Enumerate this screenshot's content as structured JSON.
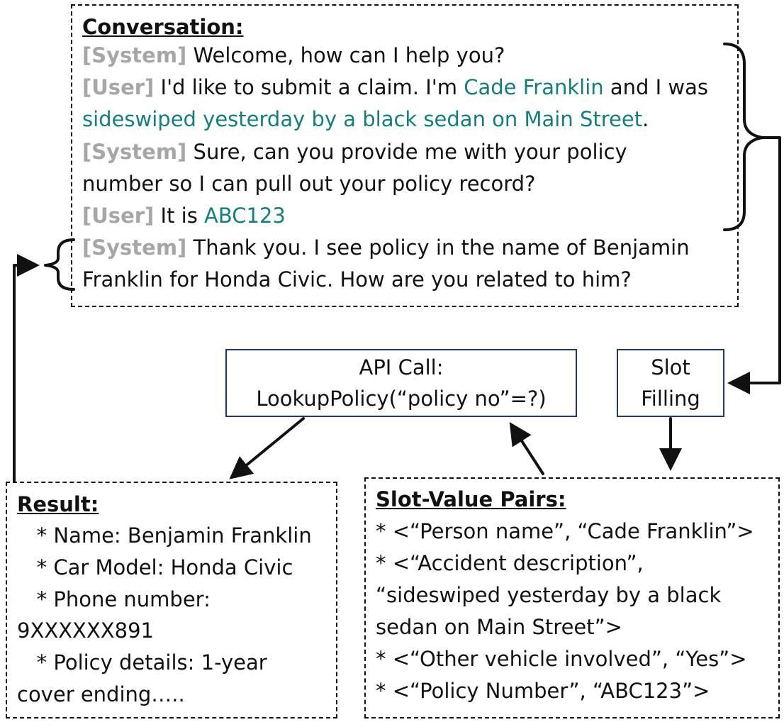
{
  "conversation": {
    "heading": "Conversation:",
    "lines": [
      {
        "tag": "[System]",
        "parts": [
          {
            "t": " Welcome, how can I help you?",
            "hl": false
          }
        ]
      },
      {
        "tag": "[User]",
        "parts": [
          {
            "t": " I'd like to submit a claim. I'm ",
            "hl": false
          },
          {
            "t": "Cade Franklin",
            "hl": true
          },
          {
            "t": " and I was",
            "hl": false
          }
        ]
      },
      {
        "tag": "",
        "parts": [
          {
            "t": "sideswiped yesterday by a black sedan on Main Street",
            "hl": true
          },
          {
            "t": ".",
            "hl": false
          }
        ]
      },
      {
        "tag": "[System]",
        "parts": [
          {
            "t": " Sure, can you provide me with your policy",
            "hl": false
          }
        ]
      },
      {
        "tag": "",
        "parts": [
          {
            "t": "number so I can pull out your policy record?",
            "hl": false
          }
        ]
      },
      {
        "tag": "[User]",
        "parts": [
          {
            "t": " It is ",
            "hl": false
          },
          {
            "t": "ABC123",
            "hl": true
          }
        ]
      },
      {
        "tag": "[System]",
        "parts": [
          {
            "t": " Thank you. I see policy in the name of Benjamin",
            "hl": false
          }
        ]
      },
      {
        "tag": "",
        "parts": [
          {
            "t": "Franklin for Honda Civic. How are you related to him?",
            "hl": false
          }
        ]
      }
    ]
  },
  "api_call": {
    "line1": "API Call:",
    "line2": "LookupPolicy(“policy no”=?)"
  },
  "slot_filling": {
    "line1": "Slot",
    "line2": "Filling"
  },
  "result": {
    "heading": "Result:",
    "lines": [
      "   * Name: Benjamin Franklin",
      "   * Car Model: Honda Civic",
      "   * Phone number:",
      "9XXXXXX891",
      "   * Policy details: 1-year",
      "cover ending….."
    ]
  },
  "slot_value_pairs": {
    "heading": "Slot-Value Pairs:",
    "lines": [
      "* <“Person name”, “Cade Franklin”>",
      "* <“Accident description”,",
      "“sideswiped yesterday by a black",
      "sedan on Main Street”>",
      "* <“Other vehicle involved”, “Yes”>",
      "* <“Policy Number”, “ABC123”>"
    ]
  },
  "colors": {
    "speaker_tag": "#a6a6a6",
    "highlight": "#127f7f",
    "box_border": "#1f3864",
    "line": "#111111"
  }
}
